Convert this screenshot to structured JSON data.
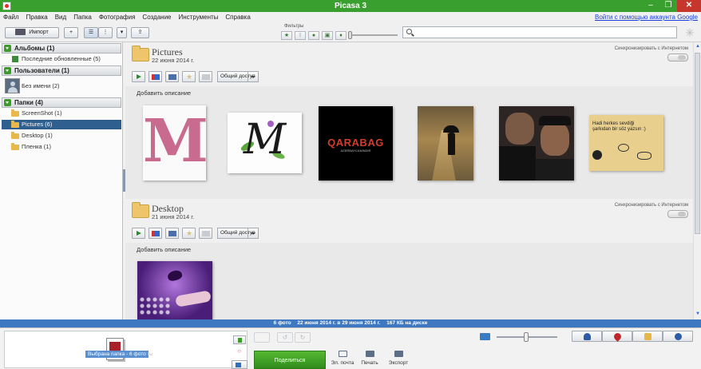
{
  "window": {
    "title": "Picasa 3",
    "minimize": "–",
    "maximize": "❐",
    "close": "✕"
  },
  "menu": {
    "items": [
      "Файл",
      "Правка",
      "Вид",
      "Папка",
      "Фотография",
      "Создание",
      "Инструменты",
      "Справка"
    ],
    "account_link": "Войти с помощью аккаунта Google"
  },
  "toolbar": {
    "import_label": "Импорт",
    "filters_label": "Фильтры",
    "filter_icons": [
      "star-icon",
      "upload-icon",
      "person-icon",
      "video-icon",
      "pin-icon"
    ],
    "search": {
      "value": "",
      "placeholder": ""
    }
  },
  "sidebar": {
    "sections": {
      "albums": "Альбомы (1)",
      "people": "Пользователи (1)",
      "folders": "Папки (4)"
    },
    "albums_items": [
      {
        "label": "Последние обновленные (5)"
      }
    ],
    "people_items": [
      {
        "label": "Без имени (2)"
      }
    ],
    "folder_items": [
      {
        "label": "ScreenShot (1)",
        "selected": false
      },
      {
        "label": "Pictures (6)",
        "selected": true
      },
      {
        "label": "Desktop (1)",
        "selected": false
      },
      {
        "label": "Пленка (1)",
        "selected": false
      }
    ]
  },
  "albums": [
    {
      "name": "Pictures",
      "date": "22 июня 2014 г.",
      "sync_label": "Синхронизировать с Интернетом",
      "share_label": "Общий доступ",
      "add_description": "Добавить описание",
      "photos": [
        {
          "kind": "m-letter",
          "text": "M"
        },
        {
          "kind": "script-m",
          "text": "M"
        },
        {
          "kind": "qarabag",
          "text": "QARABAG",
          "subtext": "AZERBAYCANINDIR"
        },
        {
          "kind": "umbrella-girl"
        },
        {
          "kind": "two-boys"
        },
        {
          "kind": "note",
          "text": "Hadi herkes sevdiği şarkıdan bir söz yazsın :)"
        }
      ]
    },
    {
      "name": "Desktop",
      "date": "21 июня 2014 г.",
      "sync_label": "Синхронизировать с Интернетом",
      "share_label": "Общий доступ",
      "add_description": "Добавить описание",
      "photos": [
        {
          "kind": "purple-butterfly"
        }
      ]
    }
  ],
  "status": {
    "count": "6 фото",
    "range": "22 июня 2014 г. в 29 июня 2014 г.",
    "size": "167 КБ на диске"
  },
  "tray": {
    "selection_label": "Выбрана папка - 6 фото",
    "hold_hint": "ты"
  },
  "actions": {
    "share": "Поделиться",
    "email": "Эл. почта",
    "print": "Печать",
    "export": "Экспорт"
  },
  "colors": {
    "titlebar": "#39a02f",
    "selection": "#2e5f8e",
    "statusbar": "#3e78c0",
    "share_button": "#3fa322"
  }
}
